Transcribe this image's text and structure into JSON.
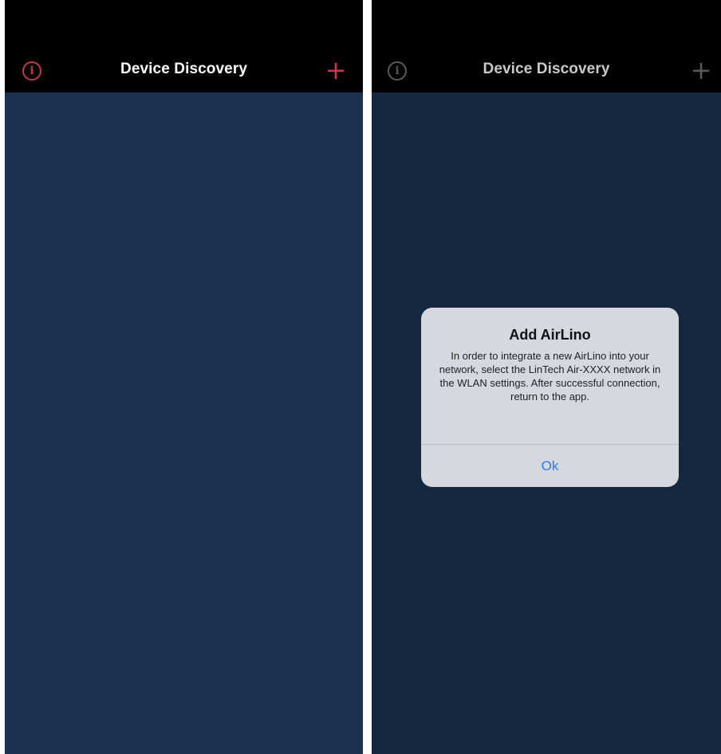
{
  "left_screen": {
    "nav": {
      "title": "Device Discovery",
      "info_icon": "info-icon",
      "add_icon": "plus-icon",
      "accent": "#d6344c"
    }
  },
  "right_screen": {
    "nav": {
      "title": "Device Discovery",
      "info_icon": "info-icon",
      "add_icon": "plus-icon"
    },
    "alert": {
      "title": "Add AirLino",
      "message": "In order to integrate a new AirLino into your network, select the LinTech Air-XXXX network in the WLAN settings. After successful connection, return to the app.",
      "ok_label": "Ok",
      "button_color": "#2f7be8"
    }
  },
  "colors": {
    "left_background": "#1b3150",
    "right_background": "#162740",
    "nav_background": "#000000"
  }
}
